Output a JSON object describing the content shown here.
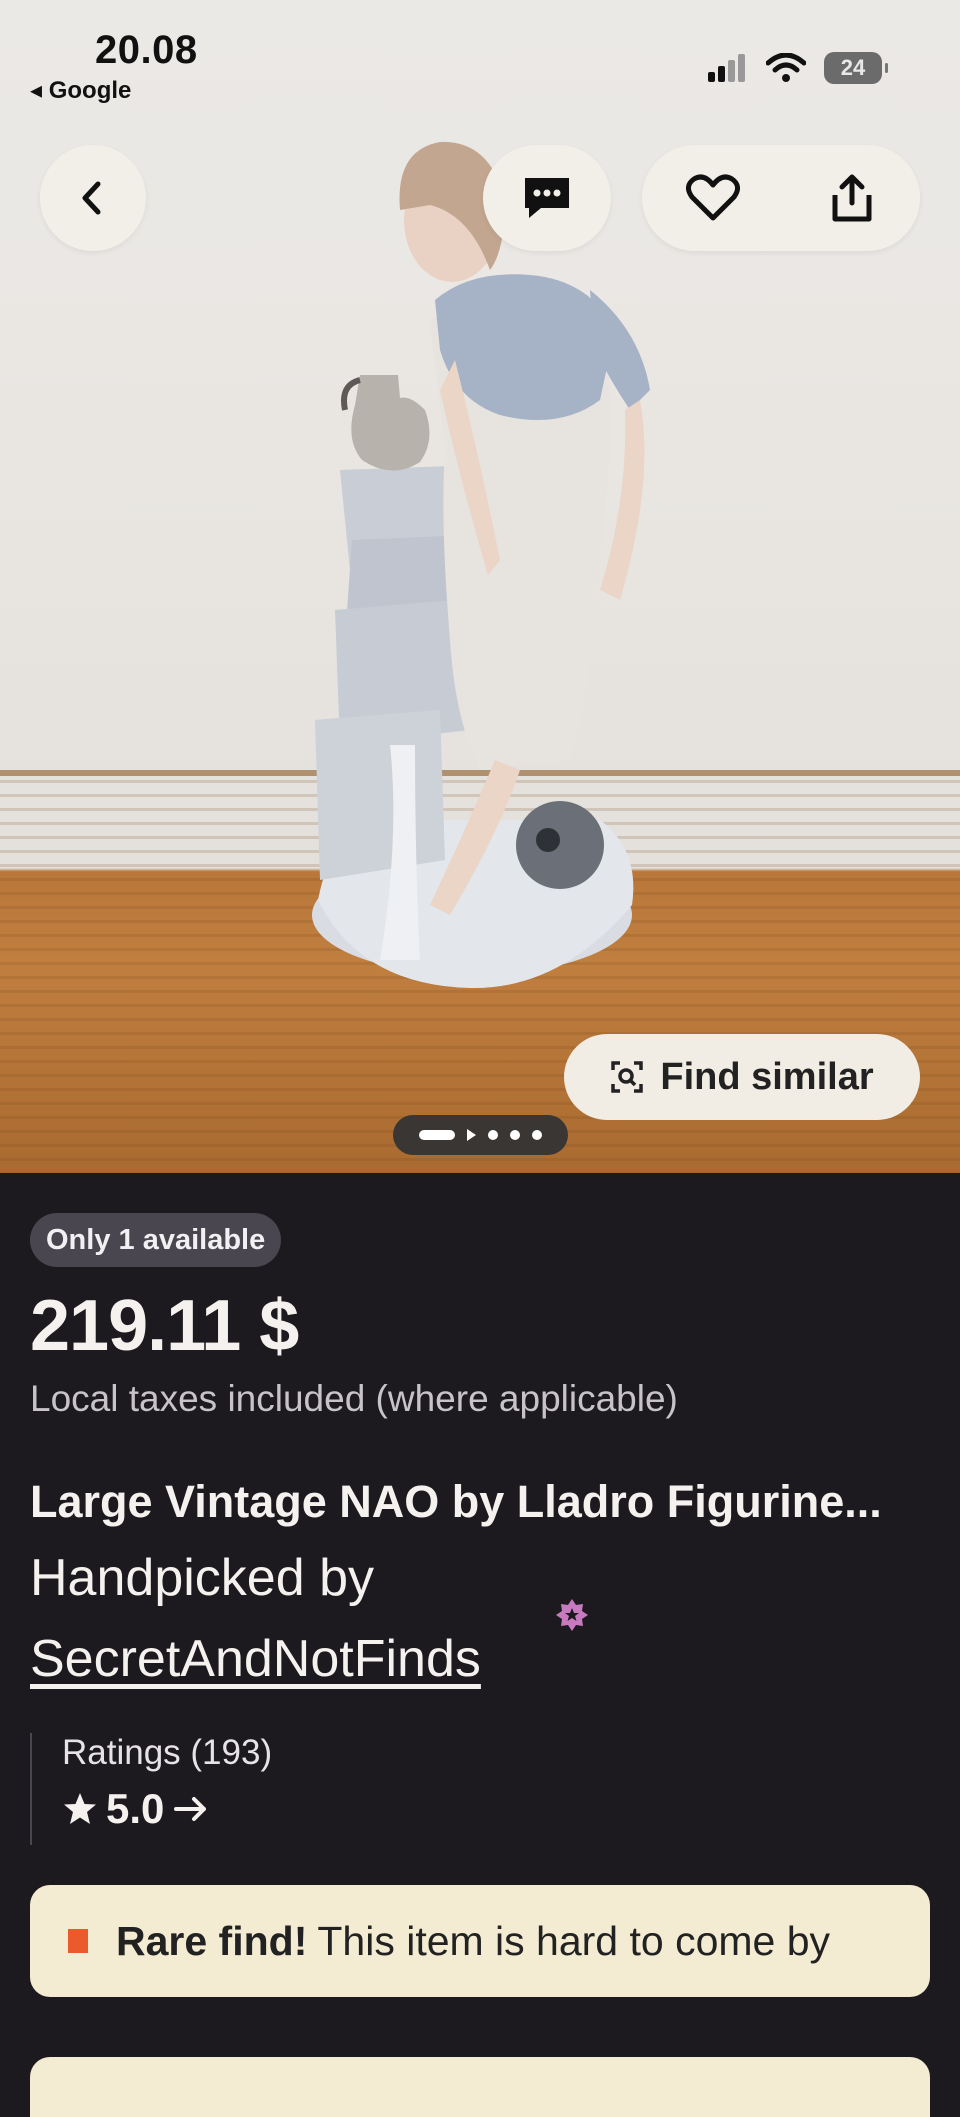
{
  "status_bar": {
    "time": "20.08",
    "back_app": "Google",
    "battery": "24"
  },
  "hero": {
    "find_similar_label": "Find similar",
    "image_count": 5,
    "active_image": 1
  },
  "listing": {
    "availability": "Only 1 available",
    "price": "219.11 $",
    "tax_note": "Local taxes included (where applicable)",
    "title": "Large Vintage NAO by Lladro Figurine...",
    "handpicked_label": "Handpicked by",
    "seller": "SecretAndNotFinds",
    "ratings_label": "Ratings (193)",
    "rating_value": "5.0",
    "rare_bold": "Rare find!",
    "rare_text": "This item is hard to come by"
  },
  "colors": {
    "background": "#1c1a1f",
    "rare_banner": "#f4ecd2",
    "rare_accent": "#ea5a2b",
    "seller_star": "#c77ac0"
  },
  "icons": {
    "back": "chevron-left-icon",
    "message": "message-dots-icon",
    "favorite": "heart-icon",
    "share": "share-icon",
    "find_similar": "visual-search-icon",
    "star": "star-icon",
    "arrow": "arrow-right-icon"
  }
}
